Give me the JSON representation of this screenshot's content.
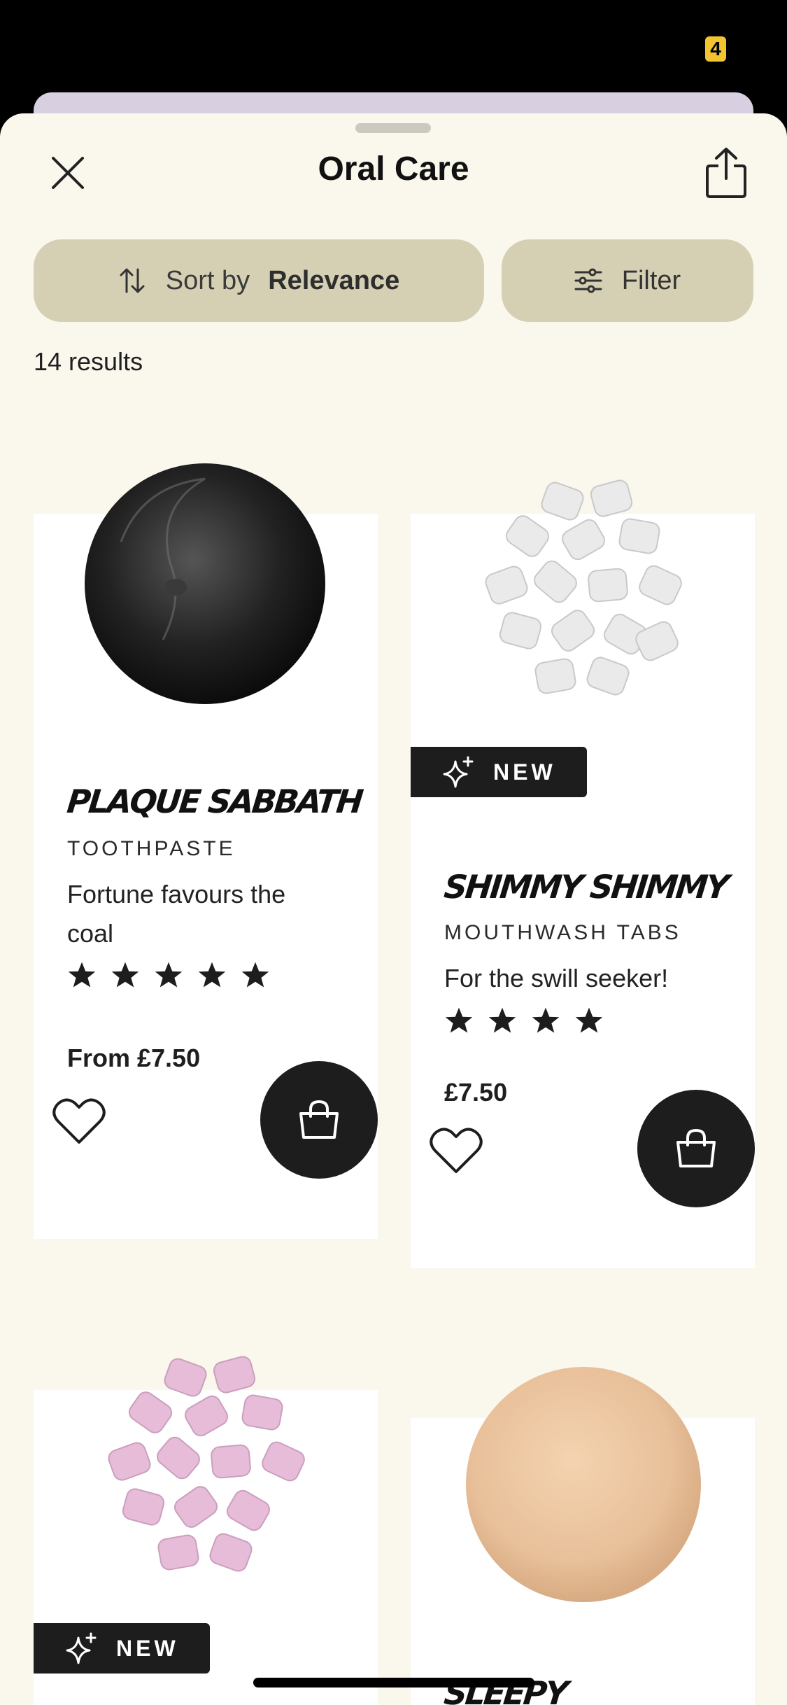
{
  "status": {
    "badge": "4"
  },
  "header": {
    "title": "Oral Care",
    "close_icon": "close-icon",
    "share_icon": "share-icon"
  },
  "toolbar": {
    "sort_label": "Sort by",
    "sort_value": "Relevance",
    "filter_label": "Filter"
  },
  "results": {
    "count_text": "14 results"
  },
  "products": [
    {
      "name": "PLAQUE SABBATH",
      "type": "TOOTHPASTE",
      "description": "Fortune favours the coal",
      "rating": 5,
      "price": "From £7.50",
      "badge": ""
    },
    {
      "name": "SHIMMY SHIMMY",
      "type": "MOUTHWASH TABS",
      "description": "For the swill seeker!",
      "rating": 4,
      "price": "£7.50",
      "badge": "NEW"
    },
    {
      "name": "",
      "badge": "NEW"
    },
    {
      "name": "SLEEPY",
      "badge": ""
    }
  ],
  "colors": {
    "sheet_bg": "#faf7ec",
    "pill_bg": "#d5d0b4",
    "dark": "#1d1d1d",
    "status_badge": "#f4c430"
  }
}
